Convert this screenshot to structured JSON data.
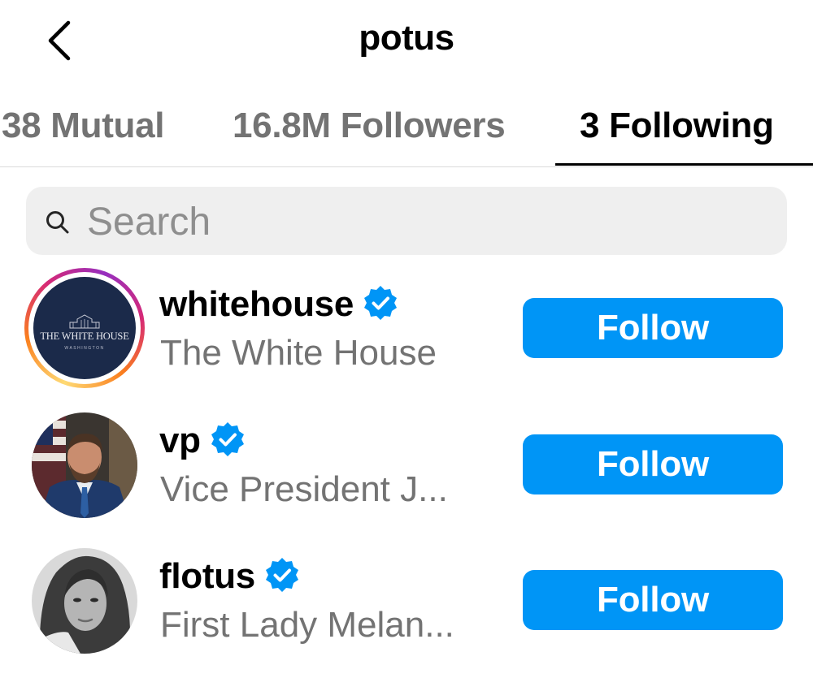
{
  "header": {
    "title": "potus",
    "back_icon": "chevron-left-icon"
  },
  "tabs": [
    {
      "label": "38 Mutual",
      "active": false
    },
    {
      "label": "16.8M Followers",
      "active": false
    },
    {
      "label": "3 Following",
      "active": true
    }
  ],
  "search": {
    "placeholder": "Search",
    "icon": "search-icon"
  },
  "accounts": [
    {
      "username": "whitehouse",
      "full_name": "The White House",
      "verified": true,
      "has_story_ring": true,
      "avatar_text": "THE WHITE HOUSE",
      "avatar_subtext": "WASHINGTON",
      "button_label": "Follow"
    },
    {
      "username": "vp",
      "full_name": "Vice President J...",
      "verified": true,
      "has_story_ring": false,
      "button_label": "Follow"
    },
    {
      "username": "flotus",
      "full_name": "First Lady Melan...",
      "verified": true,
      "has_story_ring": false,
      "button_label": "Follow"
    }
  ],
  "colors": {
    "accent": "#0095f6",
    "secondary_text": "#737373",
    "search_bg": "#efefef",
    "verified_badge": "#0095f6"
  }
}
